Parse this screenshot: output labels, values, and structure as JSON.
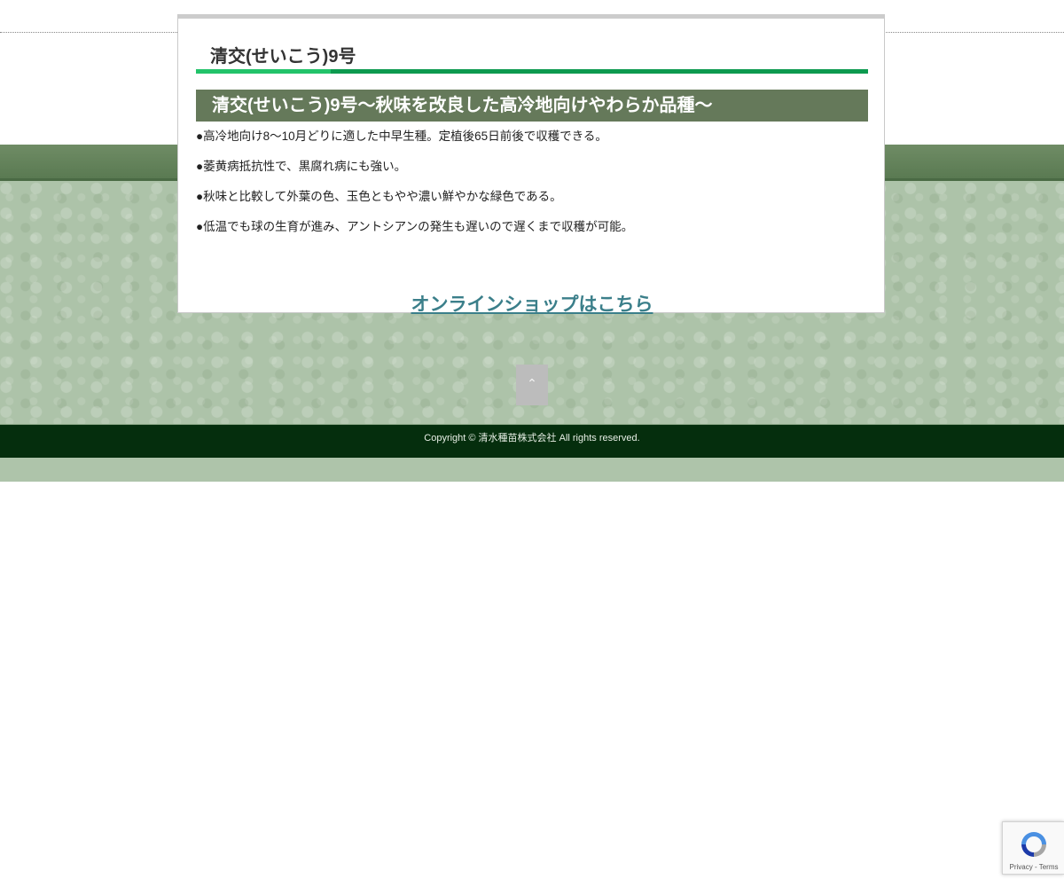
{
  "page": {
    "title": "清交(せいこう)9号",
    "section_heading": "清交(せいこう)9号〜秋味を改良した高冷地向けやわらか品種〜",
    "bullets": [
      "●高冷地向け8〜10月どりに適した中早生種。定植後65日前後で収穫できる。",
      "●萎黄病抵抗性で、黒腐れ病にも強い。",
      "●秋味と比較して外葉の色、玉色ともやや濃い鮮やかな緑色である。",
      "●低温でも球の生育が進み、アントシアンの発生も遅いので遅くまで収穫が可能。"
    ],
    "shop_link": "オンラインショップはこちら"
  },
  "back_to_top": {
    "icon": "chevron-up-icon",
    "glyph": "⌃"
  },
  "footer": {
    "copyright": "Copyright ©  清水種苗株式会社 All rights reserved."
  },
  "recaptcha": {
    "icon": "recaptcha-icon",
    "links": "Privacy - Terms"
  },
  "colors": {
    "accent_green": "#0d9a4f",
    "heading_bg": "#65795a",
    "footer_bg": "#052e0d",
    "link_color": "#3b7f8a"
  }
}
